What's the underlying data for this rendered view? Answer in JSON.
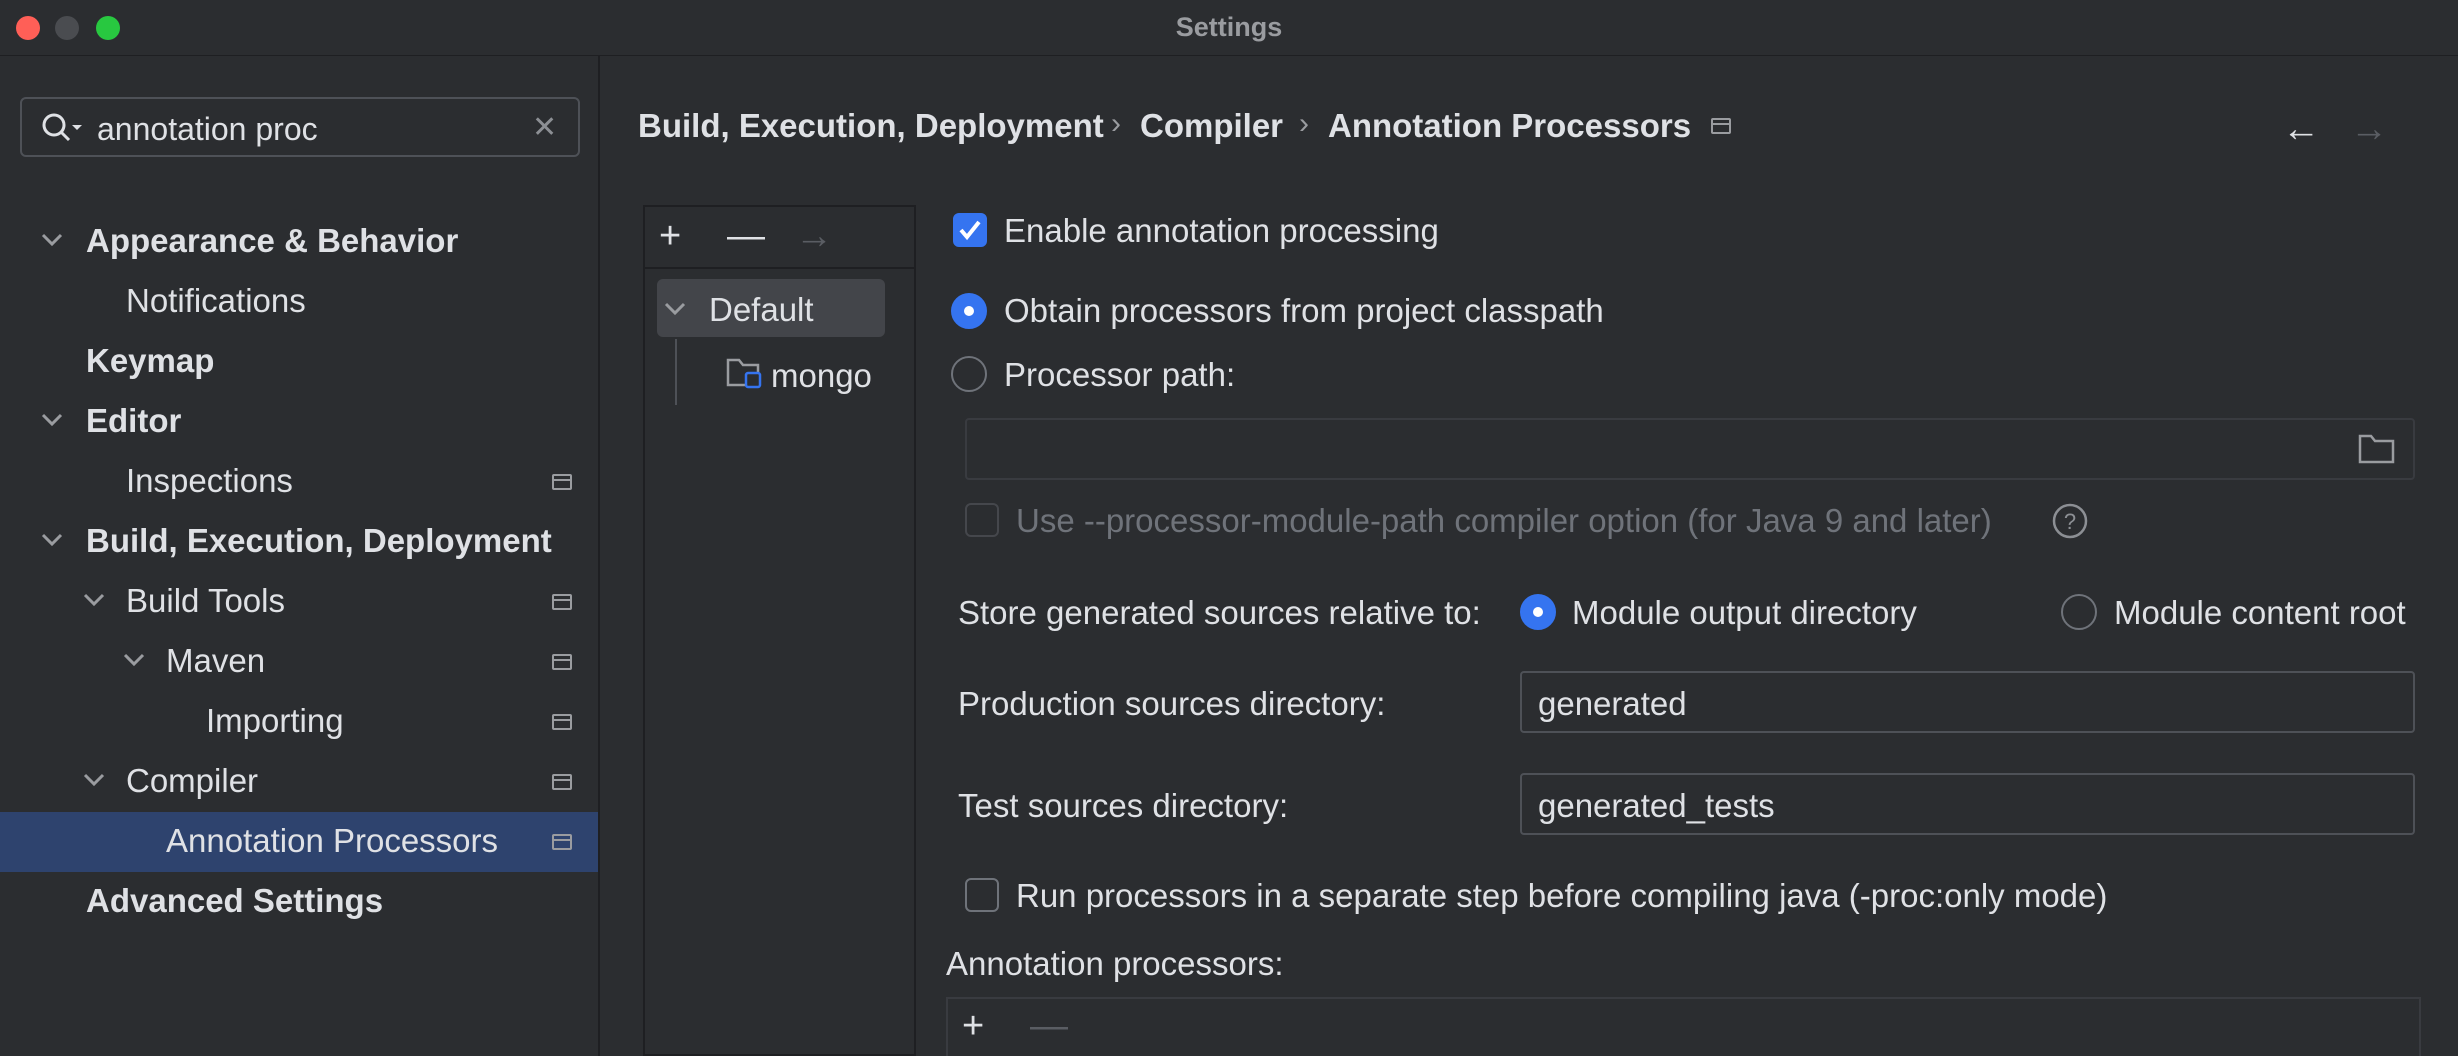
{
  "window": {
    "title": "Settings"
  },
  "search": {
    "value": "annotation proc"
  },
  "sidebar": {
    "items": [
      {
        "label": "Appearance & Behavior"
      },
      {
        "label": "Notifications"
      },
      {
        "label": "Keymap"
      },
      {
        "label": "Editor"
      },
      {
        "label": "Inspections"
      },
      {
        "label": "Build, Execution, Deployment"
      },
      {
        "label": "Build Tools"
      },
      {
        "label": "Maven"
      },
      {
        "label": "Importing"
      },
      {
        "label": "Compiler"
      },
      {
        "label": "Annotation Processors"
      },
      {
        "label": "Advanced Settings"
      }
    ]
  },
  "breadcrumb": [
    "Build, Execution, Deployment",
    "Compiler",
    "Annotation Processors"
  ],
  "profiles": {
    "default": "Default",
    "module": "mongo"
  },
  "options": {
    "enable": "Enable annotation processing",
    "obtain": "Obtain processors from project classpath",
    "processor_path": "Processor path:",
    "module_path": "Use --processor-module-path compiler option (for Java 9 and later)",
    "store_label": "Store generated sources relative to:",
    "module_output": "Module output directory",
    "module_content": "Module content root",
    "production_label": "Production sources directory:",
    "production_value": "generated",
    "test_label": "Test sources directory:",
    "test_value": "generated_tests",
    "run_separate": "Run processors in a separate step before compiling java (-proc:only mode)",
    "annotation_processors": "Annotation processors:"
  },
  "colors": {
    "accent": "#3574f0",
    "selection": "#2e436e",
    "background": "#2b2d30"
  }
}
